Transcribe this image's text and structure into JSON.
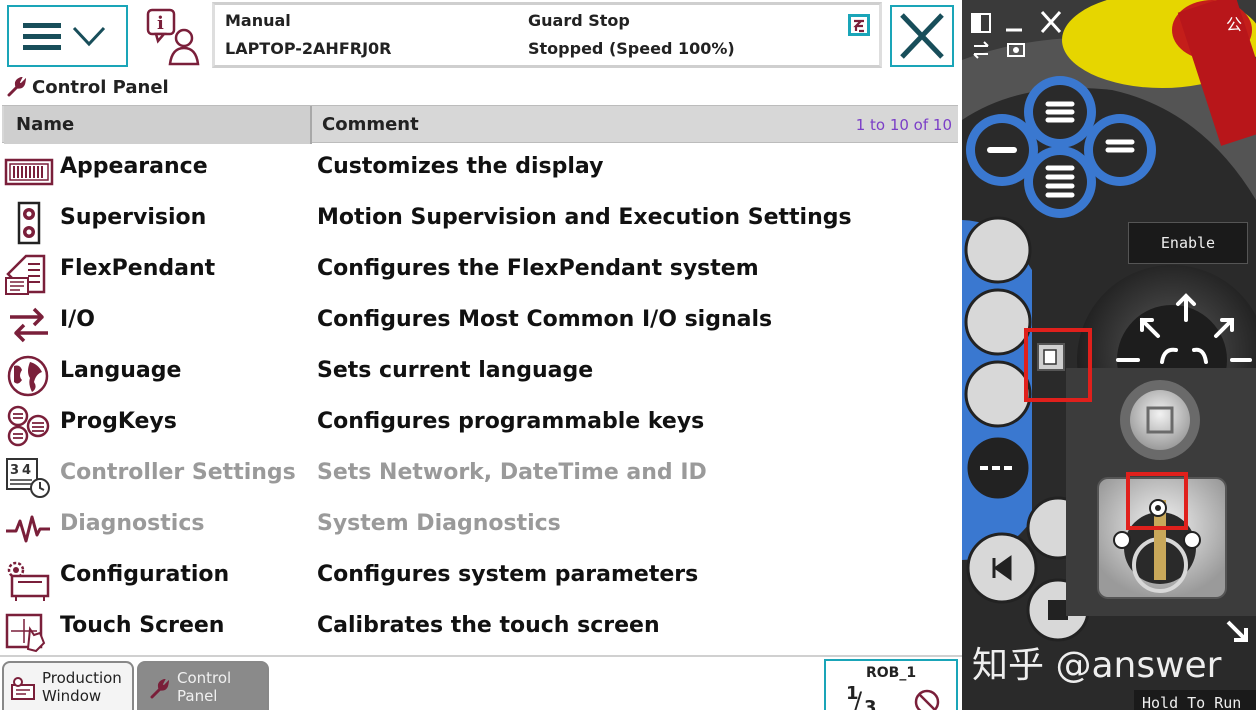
{
  "topbar": {
    "mode": "Manual",
    "controller": "LAPTOP-2AHFRJ0R",
    "safety_state": "Guard Stop",
    "run_state": "Stopped (Speed 100%)"
  },
  "panel": {
    "title": "Control Panel",
    "col_name": "Name",
    "col_comment": "Comment",
    "count": "1 to 10 of 10",
    "rows": [
      {
        "name": "Appearance",
        "comment": "Customizes the display",
        "icon": "appearance-icon",
        "enabled": true
      },
      {
        "name": "Supervision",
        "comment": "Motion Supervision and Execution Settings",
        "icon": "supervision-icon",
        "enabled": true
      },
      {
        "name": "FlexPendant",
        "comment": "Configures the FlexPendant system",
        "icon": "flexpendant-icon",
        "enabled": true
      },
      {
        "name": "I/O",
        "comment": "Configures Most Common I/O signals",
        "icon": "io-icon",
        "enabled": true
      },
      {
        "name": "Language",
        "comment": "Sets current language",
        "icon": "globe-icon",
        "enabled": true
      },
      {
        "name": "ProgKeys",
        "comment": "Configures programmable keys",
        "icon": "progkeys-icon",
        "enabled": true
      },
      {
        "name": "Controller Settings",
        "comment": "Sets Network, DateTime and ID",
        "icon": "controller-settings-icon",
        "enabled": false
      },
      {
        "name": "Diagnostics",
        "comment": "System Diagnostics",
        "icon": "diagnostics-icon",
        "enabled": false
      },
      {
        "name": "Configuration",
        "comment": "Configures system parameters",
        "icon": "configuration-icon",
        "enabled": true
      },
      {
        "name": "Touch Screen",
        "comment": "Calibrates the touch screen",
        "icon": "touch-screen-icon",
        "enabled": true
      }
    ]
  },
  "taskbar": {
    "production_line1": "Production",
    "production_line2": "Window",
    "control_line1": "Control",
    "control_line2": "Panel",
    "rob": "ROB_1",
    "fraction_num": "1",
    "fraction_den": "3"
  },
  "pendant": {
    "enable_label": "Enable",
    "hold_label": "Hold To Run",
    "watermark": "知乎 @answer",
    "corner_text": "公"
  },
  "colors": {
    "accent": "#1aa5b8",
    "icon_maroon": "#7a1f3a",
    "count_purple": "#7b3fc7",
    "pendant_blue": "#3a78d0",
    "highlight_red": "#e0201c",
    "estop_yellow": "#f0e100"
  }
}
